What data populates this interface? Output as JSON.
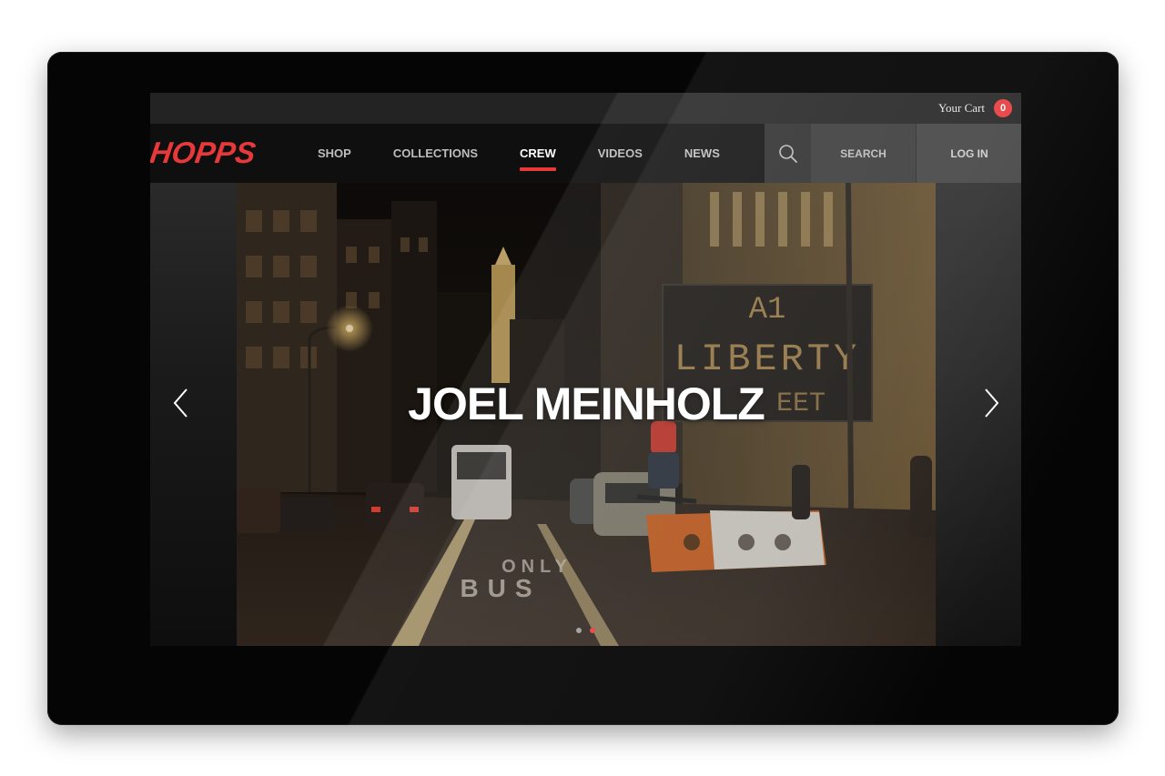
{
  "topbar": {
    "cart_label": "Your Cart",
    "cart_count": "0"
  },
  "brand": {
    "logo_text": "HOPPS",
    "accent_color": "#e8393a"
  },
  "nav": {
    "items": [
      {
        "label": "SHOP",
        "active": false
      },
      {
        "label": "COLLECTIONS",
        "active": false
      },
      {
        "label": "CREW",
        "active": true
      },
      {
        "label": "VIDEOS",
        "active": false
      },
      {
        "label": "NEWS",
        "active": false
      }
    ],
    "search_label": "SEARCH",
    "login_label": "LOG IN"
  },
  "hero": {
    "title": "JOEL MEINHOLZ",
    "slide_count": 2,
    "active_slide": 2
  },
  "icons": [
    "search-icon",
    "chevron-left-icon",
    "chevron-right-icon"
  ]
}
